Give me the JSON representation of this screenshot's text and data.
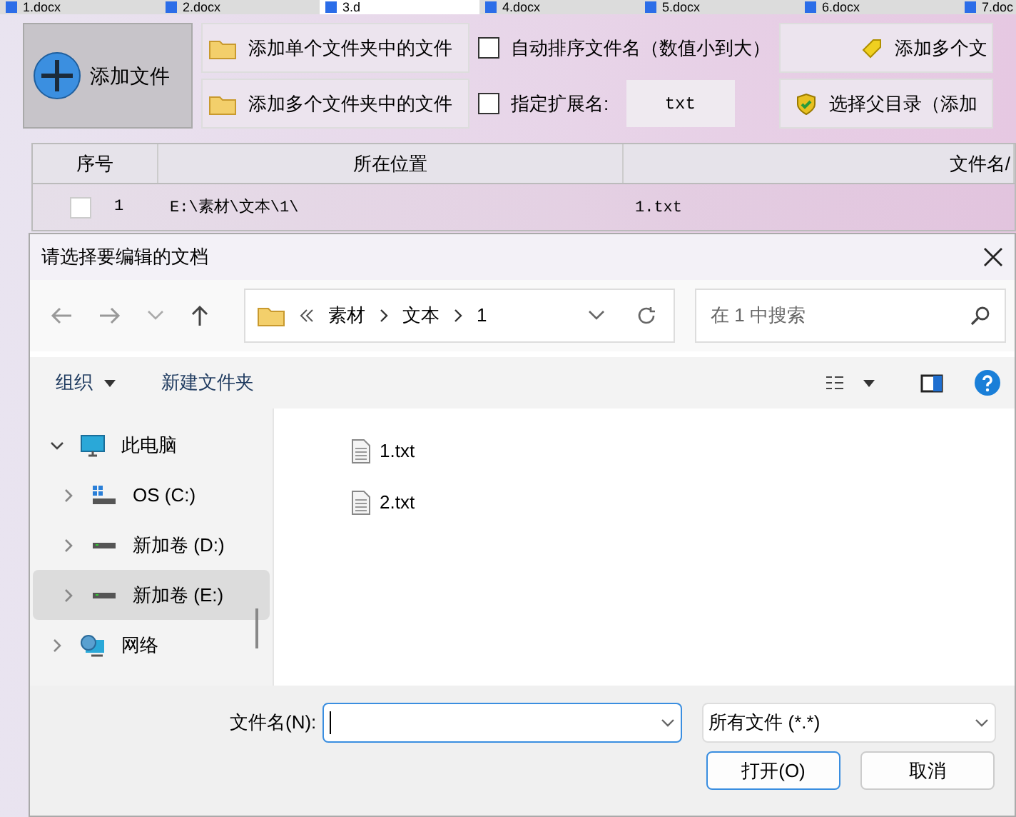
{
  "doc_tabs": [
    {
      "label": "1.docx",
      "selected": false
    },
    {
      "label": "2.docx",
      "selected": false
    },
    {
      "label": "3.d",
      "selected": true
    },
    {
      "label": "4.docx",
      "selected": false
    },
    {
      "label": "5.docx",
      "selected": false
    },
    {
      "label": "6.docx",
      "selected": false
    },
    {
      "label": "7.doc",
      "selected": false
    }
  ],
  "toolbar": {
    "add_file": "添加文件",
    "folder_buttons": [
      "添加单个文件夹中的文件",
      "添加多个文件夹中的文件"
    ],
    "options": [
      {
        "label": "自动排序文件名（数值小到大）",
        "checked": false
      },
      {
        "label": "指定扩展名:",
        "checked": false
      }
    ],
    "extension": "txt",
    "right_buttons": [
      {
        "kind": "add",
        "label": "添加多个文"
      },
      {
        "kind": "parent",
        "label": "选择父目录（添加"
      }
    ]
  },
  "table": {
    "columns": [
      "序号",
      "所在位置",
      "文件名/"
    ],
    "rows": [
      {
        "checked": false,
        "index": "1",
        "location": "E:\\素材\\文本\\1\\",
        "name": "1.txt"
      }
    ]
  },
  "dialog": {
    "title": "请选择要编辑的文档",
    "breadcrumb": [
      "素材",
      "文本",
      "1"
    ],
    "search": {
      "placeholder": "在 1 中搜索"
    },
    "commands": [
      {
        "label": "组织",
        "dropdown": true
      },
      {
        "label": "新建文件夹",
        "dropdown": false
      }
    ],
    "tree": [
      {
        "kind": "pc",
        "label": "此电脑",
        "expanded": true,
        "selected": false,
        "children": [
          {
            "kind": "os",
            "label": "OS (C:)",
            "expanded": false,
            "selected": false
          },
          {
            "kind": "drive",
            "label": "新加卷 (D:)",
            "expanded": false,
            "selected": false
          },
          {
            "kind": "drive",
            "label": "新加卷 (E:)",
            "expanded": false,
            "selected": true
          }
        ]
      },
      {
        "kind": "network",
        "label": "网络",
        "expanded": false,
        "selected": false
      }
    ],
    "files": [
      "1.txt",
      "2.txt"
    ],
    "filename": {
      "label": "文件名(N):"
    },
    "filetype": "所有文件 (*.*)",
    "buttons": [
      {
        "label": "打开(O)",
        "default": true
      },
      {
        "label": "取消",
        "default": false
      }
    ]
  }
}
